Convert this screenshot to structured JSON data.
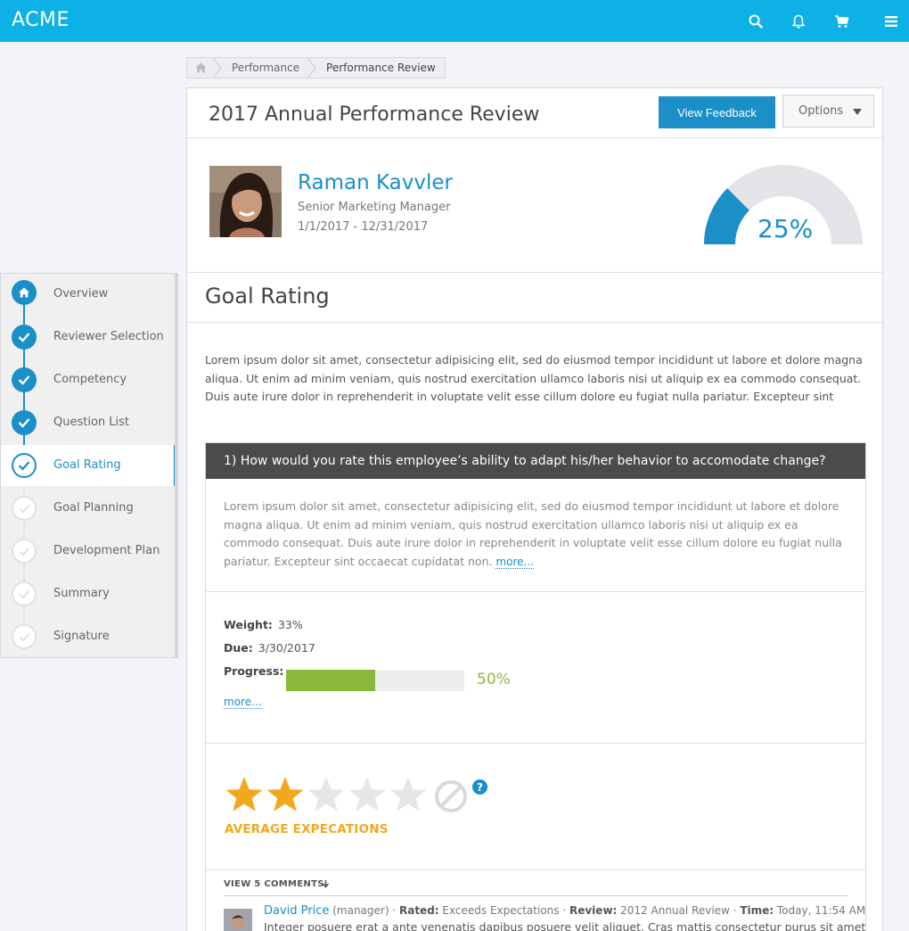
{
  "app": {
    "brand": "ACME"
  },
  "topbar": {
    "icons": [
      "search-icon",
      "bell-icon",
      "cart-icon",
      "menu-icon"
    ]
  },
  "breadcrumb": {
    "items": [
      "Performance",
      "Performance Review"
    ]
  },
  "sidebar": {
    "items": [
      {
        "label": "Overview",
        "state": "done",
        "icon": "home-icon"
      },
      {
        "label": "Reviewer Selection",
        "state": "done"
      },
      {
        "label": "Competency",
        "state": "done"
      },
      {
        "label": "Question List",
        "state": "done"
      },
      {
        "label": "Goal Rating",
        "state": "current"
      },
      {
        "label": "Goal Planning",
        "state": "todo"
      },
      {
        "label": "Development Plan",
        "state": "todo"
      },
      {
        "label": "Summary",
        "state": "todo"
      },
      {
        "label": "Signature",
        "state": "todo"
      }
    ]
  },
  "review": {
    "title": "2017 Annual Performance Review",
    "view_feedback_label": "View Feedback",
    "options_label": "Options",
    "employee": {
      "name": "Raman Kavvler",
      "role": "Senior Marketing Manager",
      "dates": "1/1/2017 - 12/31/2017"
    },
    "completion_percent": 25,
    "completion_label": "25%"
  },
  "goal_rating": {
    "title": "Goal Rating",
    "intro": "Lorem ipsum dolor sit amet, consectetur adipisicing elit, sed do eiusmod tempor incididunt ut labore et dolore magna aliqua. Ut enim ad minim veniam, quis nostrud exercitation ullamco laboris nisi ut aliquip ex ea commodo consequat. Duis aute irure dolor in reprehenderit in voluptate velit esse cillum dolore eu fugiat nulla pariatur. Excepteur sint"
  },
  "question": {
    "header": "1) How would you rate this employee’s ability to adapt his/her behavior to accomodate change?",
    "text": "Lorem ipsum dolor sit amet, consectetur adipisicing elit, sed do eiusmod tempor incididunt ut labore et dolore magna aliqua. Ut enim ad minim veniam, quis nostrud exercitation ullamco laboris nisi ut aliquip ex ea commodo consequat. Duis aute irure dolor in reprehenderit in voluptate velit esse cillum dolore eu fugiat nulla pariatur. Excepteur sint occaecat cupidatat non.",
    "more_label": "more...",
    "weight_label": "Weight:",
    "weight_value": "33%",
    "due_label": "Due:",
    "due_value": "3/30/2017",
    "progress_label": "Progress:",
    "progress_percent": 50,
    "progress_text": "50%",
    "details_more_label": "more...",
    "rating": {
      "filled_stars": 2,
      "total_stars": 5,
      "label": "AVERAGE EXPECATIONS",
      "color": "#f2a81d"
    },
    "help_label": "?"
  },
  "comments": {
    "toggle_label": "VIEW 5 COMMENTS",
    "items": [
      {
        "author": "David Price",
        "role": "(manager) ·",
        "rated_label": "Rated:",
        "rated_value": "Exceeds Expectations ·",
        "review_label": "Review:",
        "review_value": "2012 Annual Review ·",
        "time_label": "Time:",
        "time_value": "Today, 11:54 AM",
        "body": "Integer posuere erat a ante venenatis dapibus posuere velit aliquet. Cras mattis consectetur purus sit amet"
      }
    ]
  },
  "colors": {
    "topbar": "#0db1e6",
    "accent": "#1a8fc8",
    "progress": "#8ab83a",
    "star": "#f2a81d",
    "header_dark": "#4b4b4b"
  }
}
